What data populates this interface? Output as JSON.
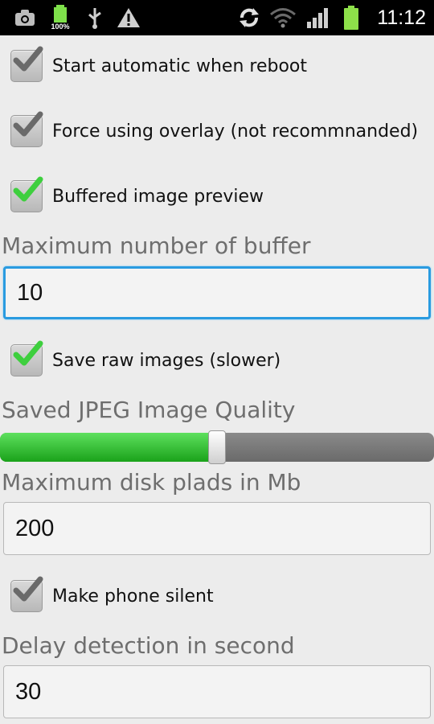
{
  "status_bar": {
    "time": "11:12",
    "battery_text": "100%",
    "icons": [
      "camera-icon",
      "battery-charging-icon",
      "usb-icon",
      "warning-icon",
      "sync-icon",
      "wifi-icon",
      "signal-icon",
      "battery-icon"
    ]
  },
  "settings": {
    "start_automatic": {
      "label": "Start automatic when reboot",
      "checked": true
    },
    "force_overlay": {
      "label": "Force using overlay (not recommnanded)",
      "checked": true
    },
    "buffered_preview": {
      "label": "Buffered image preview",
      "checked": true
    },
    "max_buffer": {
      "label": "Maximum number of buffer",
      "value": "10"
    },
    "save_raw": {
      "label": "Save raw images (slower)",
      "checked": true
    },
    "jpeg_quality": {
      "label": "Saved JPEG Image Quality",
      "level_percent": 50
    },
    "max_disk": {
      "label": "Maximum disk plads in Mb",
      "value": "200"
    },
    "phone_silent": {
      "label": "Make phone silent",
      "checked": true
    },
    "delay_detection": {
      "label": "Delay detection in second",
      "value": "30"
    }
  },
  "colors": {
    "accent_focus": "#2a9be0",
    "slider_fill": "#2dbb2d",
    "check_green": "#3ecf3e",
    "check_gray": "#6a6a6a"
  }
}
